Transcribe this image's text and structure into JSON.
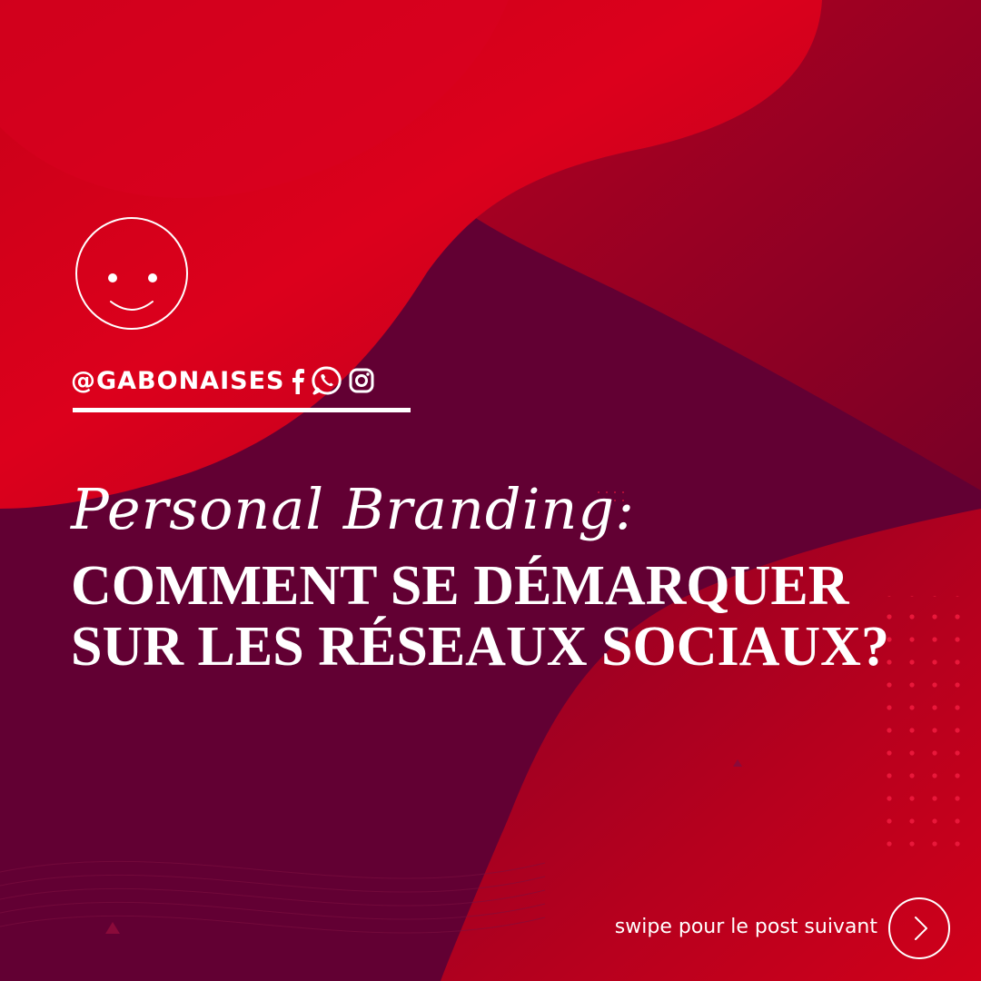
{
  "colors": {
    "background_dark": "#620033",
    "red_bright": "#d8001c",
    "red_mid": "#a00022",
    "text": "#ffffff",
    "dot_accent": "#e8183a"
  },
  "header": {
    "avatar_icon": "smiley-face-icon",
    "handle": "@GABONAISES",
    "social_icons": [
      "facebook-icon",
      "whatsapp-icon",
      "instagram-icon"
    ]
  },
  "title": {
    "script_line": "Personal Branding:",
    "headline_line1": "COMMENT SE DÉMARQUER",
    "headline_line2": "SUR LES RÉSEAUX SOCIAUX?"
  },
  "footer": {
    "swipe_label": "swipe pour le post suivant",
    "next_icon": "chevron-right-icon"
  }
}
